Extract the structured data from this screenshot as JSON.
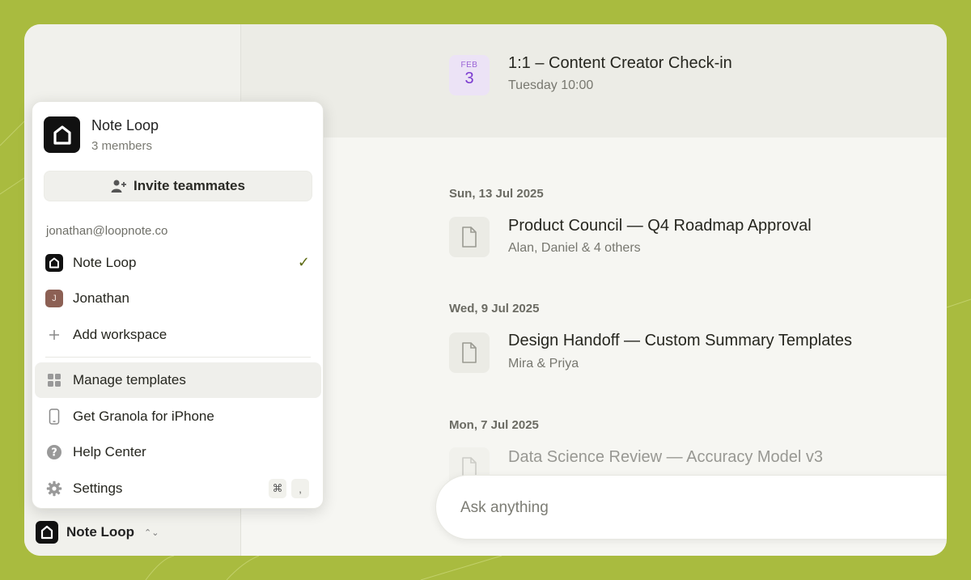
{
  "upcoming": {
    "event": {
      "month": "FEB",
      "day": "3",
      "title": "1:1 – Content Creator Check-in",
      "subtitle": "Tuesday 10:00"
    }
  },
  "meetings": [
    {
      "date": "Sun, 13 Jul 2025",
      "title": "Product Council — Q4 Roadmap Approval",
      "subtitle": "Alan, Daniel & 4 others"
    },
    {
      "date": "Wed, 9 Jul 2025",
      "title": "Design Handoff — Custom Summary Templates",
      "subtitle": "Mira & Priya"
    },
    {
      "date": "Mon, 7 Jul 2025",
      "title": "Data Science Review — Accuracy Model v3",
      "subtitle": ""
    }
  ],
  "ask": {
    "placeholder": "Ask anything"
  },
  "sidebar": {
    "workspace_name": "Note Loop"
  },
  "popup": {
    "workspace_name": "Note Loop",
    "members": "3 members",
    "invite_label": "Invite teammates",
    "email": "jonathan@loopnote.co",
    "workspaces": [
      {
        "label": "Note Loop",
        "selected": true
      },
      {
        "label": "Jonathan",
        "avatar_initial": "J"
      }
    ],
    "add_workspace": "Add workspace",
    "menu": [
      {
        "label": "Manage templates",
        "icon": "grid-icon"
      },
      {
        "label": "Get Granola for iPhone",
        "icon": "phone-icon"
      },
      {
        "label": "Help Center",
        "icon": "help-icon"
      },
      {
        "label": "Settings",
        "icon": "gear-icon",
        "shortcut": [
          "⌘",
          ","
        ]
      }
    ]
  },
  "colors": {
    "background": "#a9bb3f",
    "accent_purple": "#7b3ad0",
    "check_green": "#5d6b12"
  }
}
